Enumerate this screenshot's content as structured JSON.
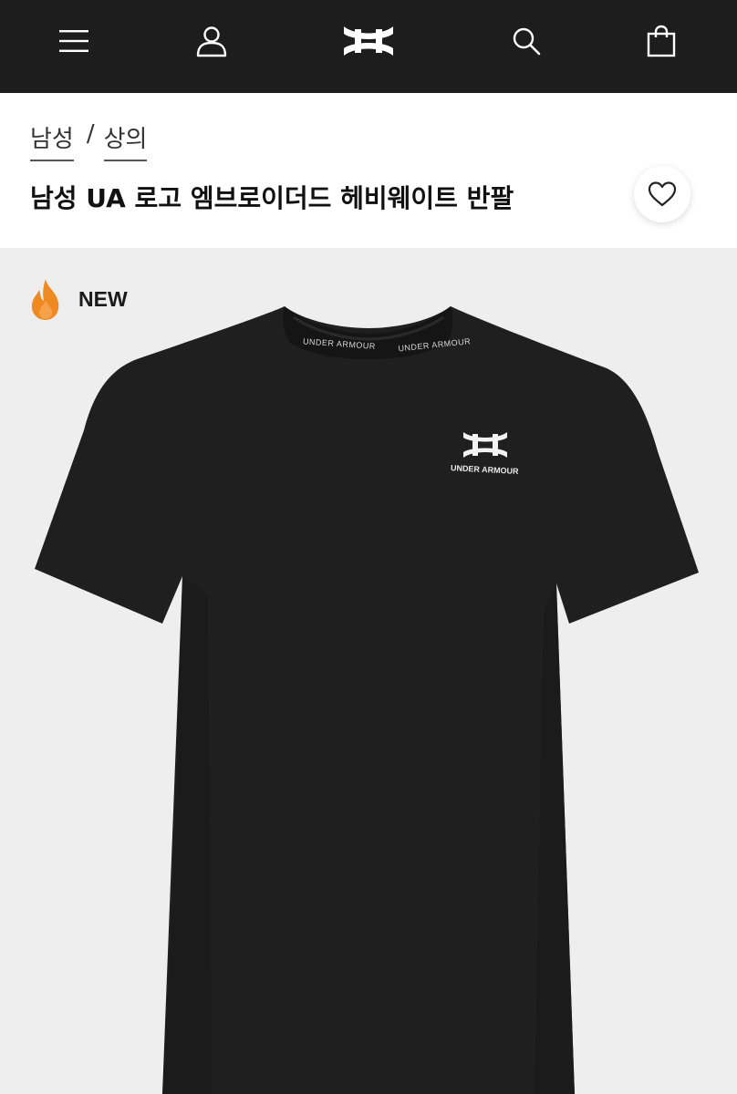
{
  "nav": {
    "icons": [
      "menu-icon",
      "account-icon",
      "brand-logo",
      "search-icon",
      "shopping-bag-icon"
    ]
  },
  "breadcrumb": {
    "items": [
      {
        "label": "남성"
      },
      {
        "label": "상의"
      }
    ],
    "separator": "/"
  },
  "product": {
    "title": "남성 UA 로고 엠브로이더드 헤비웨이트 반팔",
    "badge": "NEW",
    "badge_icon": "flame-icon",
    "wishlist_icon": "heart-icon",
    "collar_print": "UNDER ARMOUR",
    "chest_print": "UNDER ARMOUR"
  },
  "colors": {
    "topbar": "#1d1d1d",
    "header_bg": "#ffffff",
    "image_bg": "#eeeeee",
    "shirt": "#1f1f20",
    "flame": "#ef8a22",
    "text": "#111111"
  }
}
